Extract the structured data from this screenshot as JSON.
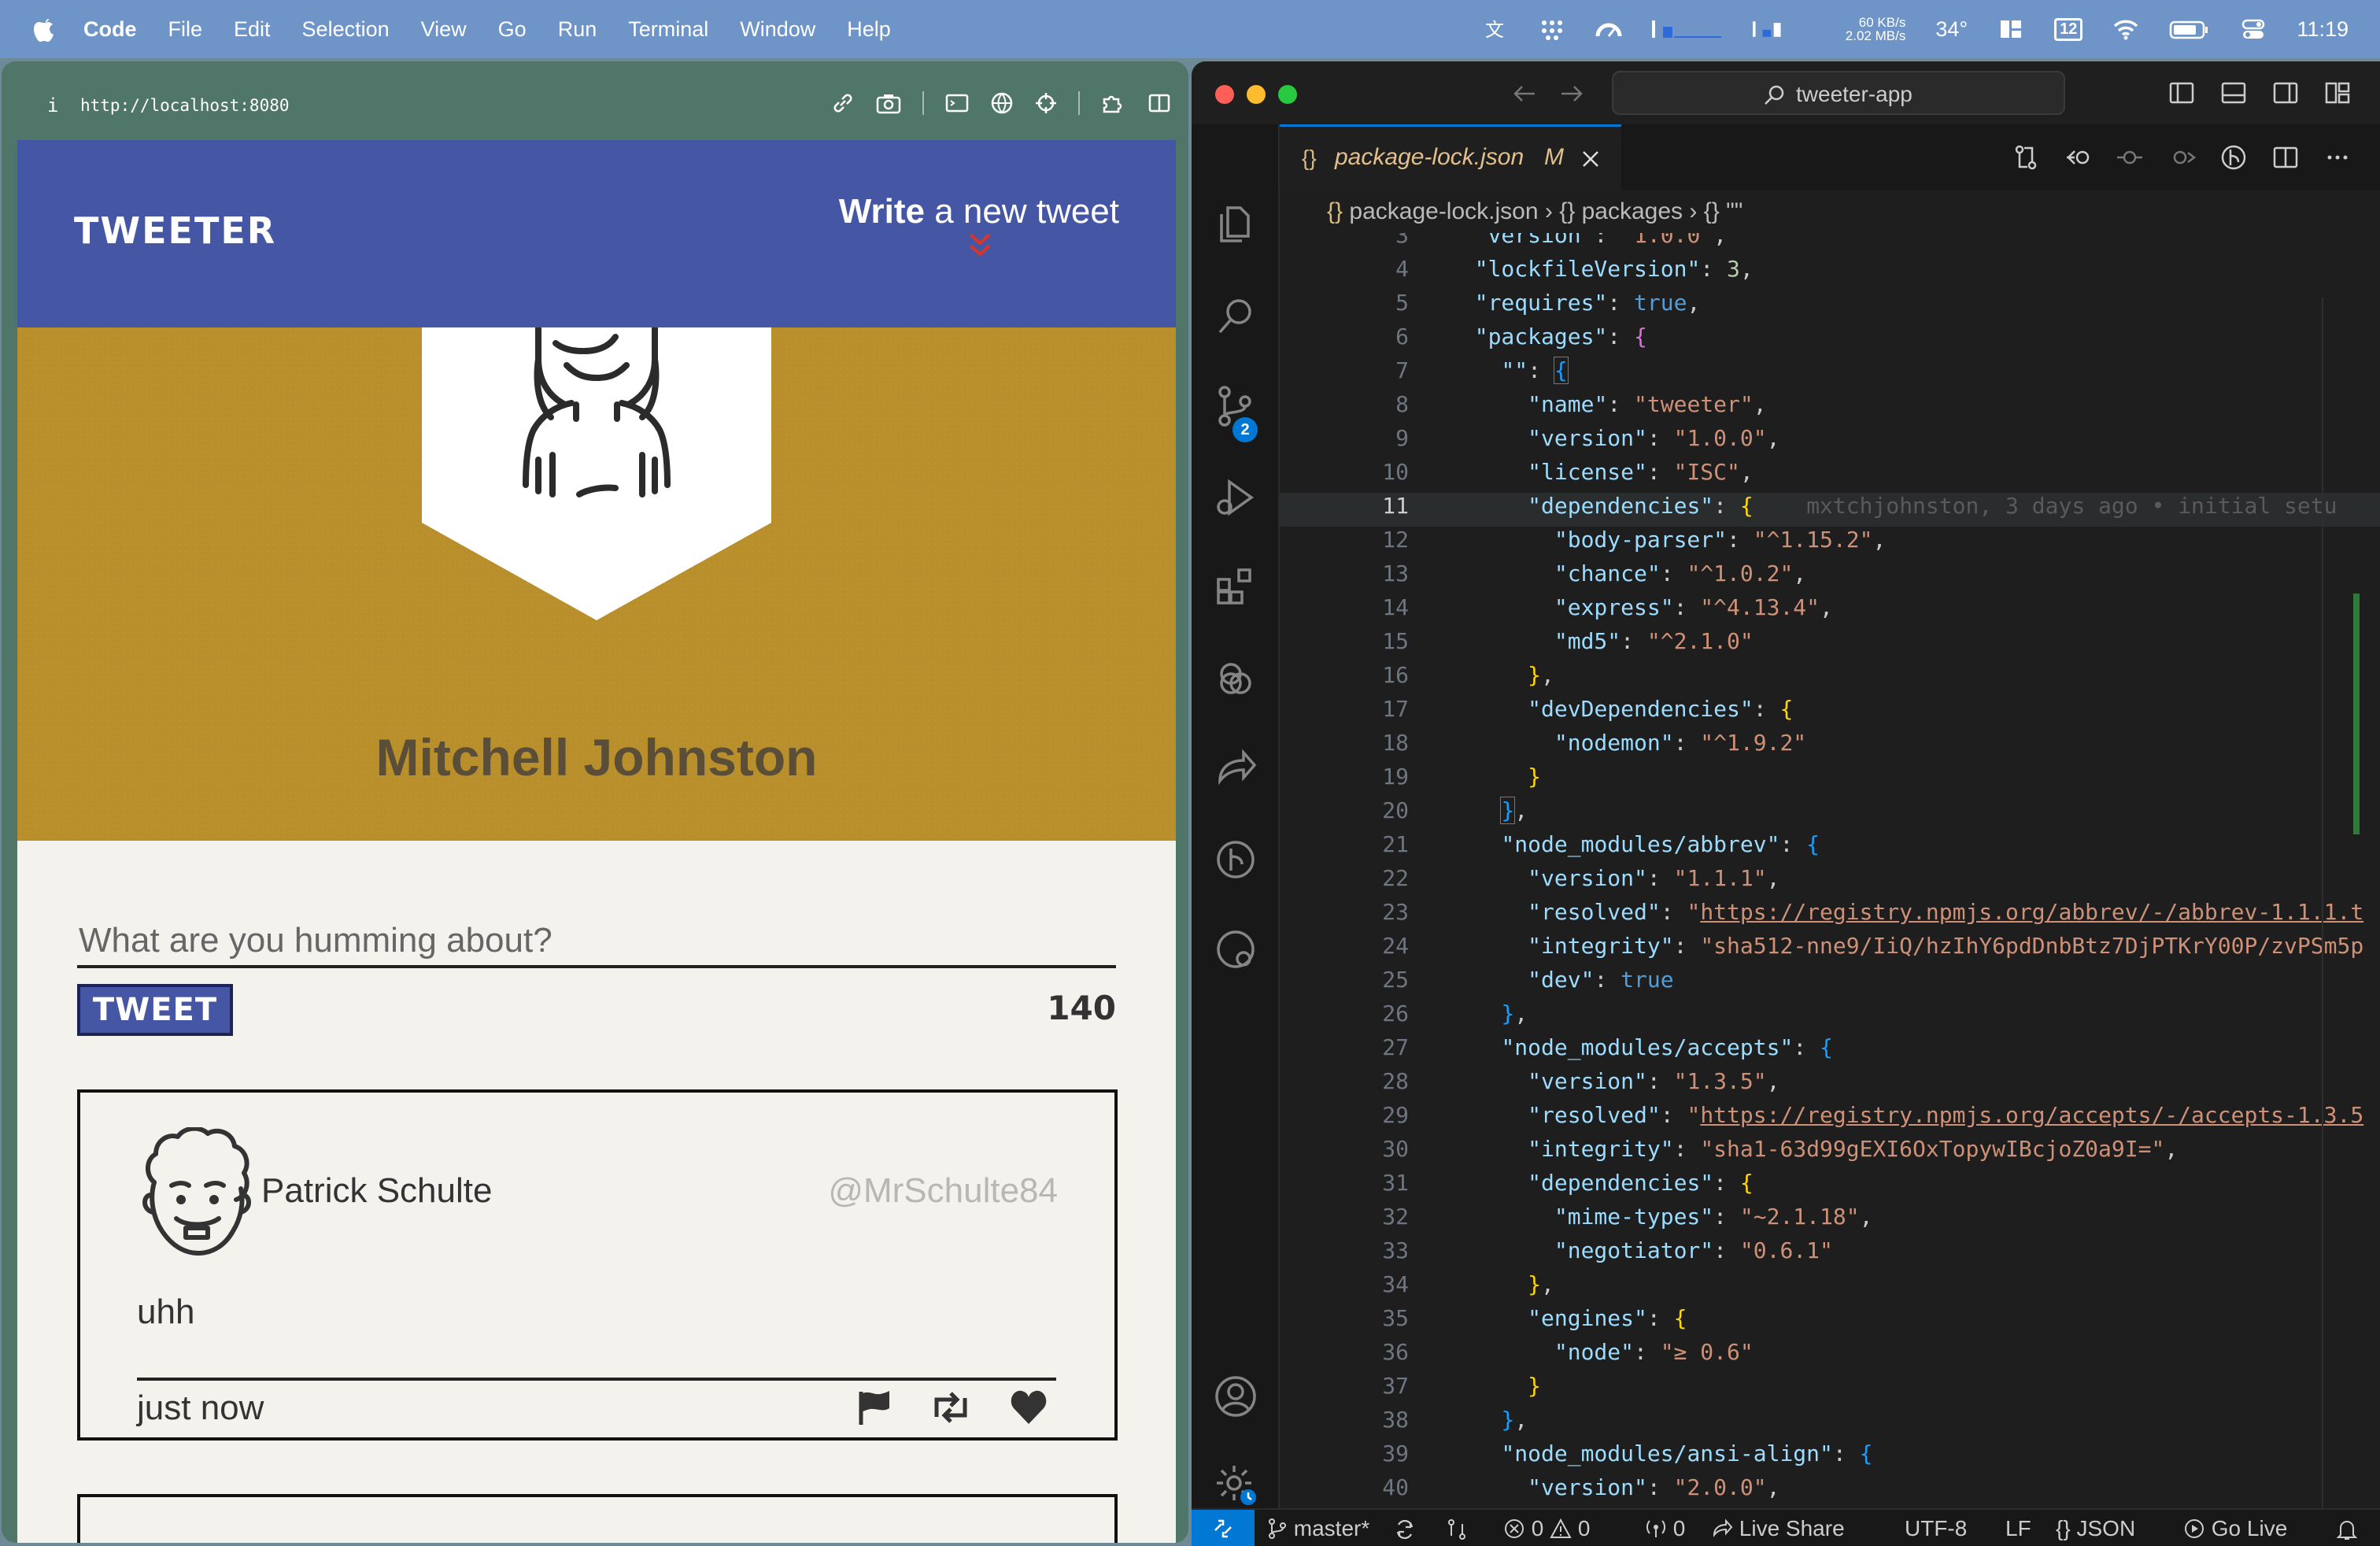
{
  "menubar": {
    "app_name": "Code",
    "items": [
      "File",
      "Edit",
      "Selection",
      "View",
      "Go",
      "Run",
      "Terminal",
      "Window",
      "Help"
    ],
    "net_up": "60 KB/s",
    "net_down": "2.02 MB/s",
    "temperature": "34°",
    "calendar_day": "12",
    "clock": "11:19"
  },
  "browser": {
    "url": "http://localhost:8080",
    "info_icon": "i",
    "brand": "TWEETER",
    "compose_bold": "Write",
    "compose_rest": " a new tweet",
    "profile_name": "Mitchell Johnston",
    "input_placeholder": "What are you humming about?",
    "tweet_button": "TWEET",
    "char_counter": "140",
    "tweets": [
      {
        "author": "Patrick Schulte",
        "handle": "@MrSchulte84",
        "text": "uhh",
        "time": "just now"
      }
    ]
  },
  "vscode": {
    "command_center": "tweeter-app",
    "tab": {
      "name": "package-lock.json",
      "status": "M",
      "icon": "{}"
    },
    "breadcrumb": [
      "package-lock.json",
      "packages",
      "\"\""
    ],
    "scm_badge": "2",
    "blame": "mxtchjohnston, 3 days ago • initial setu",
    "status": {
      "branch": "master*",
      "errors": "0",
      "warnings": "0",
      "ports": "0",
      "live_share": "Live Share",
      "encoding": "UTF-8",
      "eol": "LF",
      "language": "JSON",
      "go_live": "Go Live"
    }
  },
  "colors": {
    "menubar_bg": "#6f95c8",
    "tweeter_nav": "#4557a4",
    "profile_banner": "#b88f2b",
    "vscode_bg": "#1e1e1e",
    "accent_blue": "#0078d4"
  }
}
